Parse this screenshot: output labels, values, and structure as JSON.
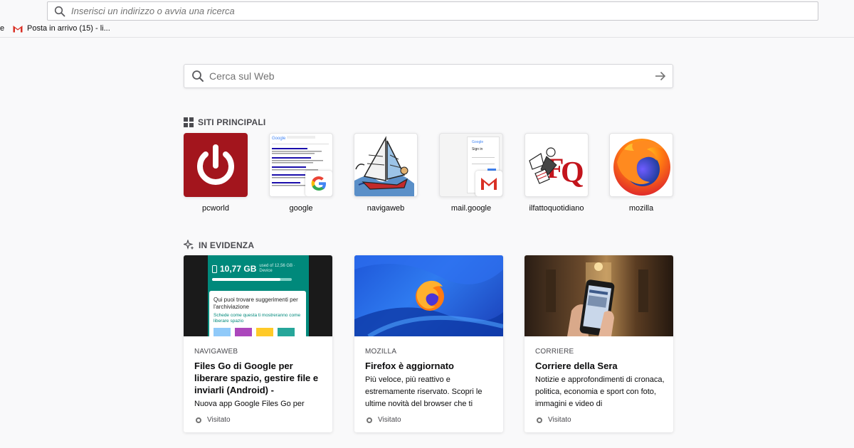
{
  "urlbar": {
    "placeholder": "Inserisci un indirizzo o avvia una ricerca"
  },
  "bookmarks": {
    "cut_text": "e",
    "items": [
      {
        "label": "Posta in arrivo (15) - li...",
        "icon": "gmail-icon"
      }
    ]
  },
  "search": {
    "placeholder": "Cerca sul Web"
  },
  "top_sites": {
    "title": "SITI PRINCIPALI",
    "tiles": [
      {
        "label": "pcworld",
        "icon": "power-icon"
      },
      {
        "label": "google",
        "icon": "google-icon"
      },
      {
        "label": "navigaweb",
        "icon": "sailboat-icon"
      },
      {
        "label": "mail.google",
        "icon": "gmail-icon"
      },
      {
        "label": "ilfattoquotidiano",
        "icon": "fq-logo"
      },
      {
        "label": "mozilla",
        "icon": "firefox-icon"
      }
    ]
  },
  "highlights": {
    "title": "IN EVIDENZA",
    "cards": [
      {
        "source": "NAVIGAWEB",
        "title": "Files Go di Google per liberare spazio, gestire file e inviarli (Android) -",
        "description": "Nuova app Google Files Go per",
        "status": "Visitato",
        "image": {
          "storage": "10,77 GB",
          "storage_sub": "used of 12,56 GB · Device",
          "tip_title": "Qui puoi trovare suggerimenti per l'archiviazione",
          "tip_body": "Schede come questa ti mostreranno come liberare spazio"
        }
      },
      {
        "source": "MOZILLA",
        "title": "Firefox è aggiornato",
        "description": "Più veloce, più reattivo e estremamente riservato. Scopri le ultime novità del browser che ti",
        "status": "Visitato"
      },
      {
        "source": "CORRIERE",
        "title": "Corriere della Sera",
        "description": "Notizie e approfondimenti di cronaca, politica, economia e sport con foto, immagini e video di",
        "status": "Visitato"
      }
    ]
  },
  "colors": {
    "pcworld_red": "#a3151d",
    "firefox_orange": "#ff7a12",
    "firefox_blue": "#1e56d8",
    "gmail_red": "#d93025"
  }
}
